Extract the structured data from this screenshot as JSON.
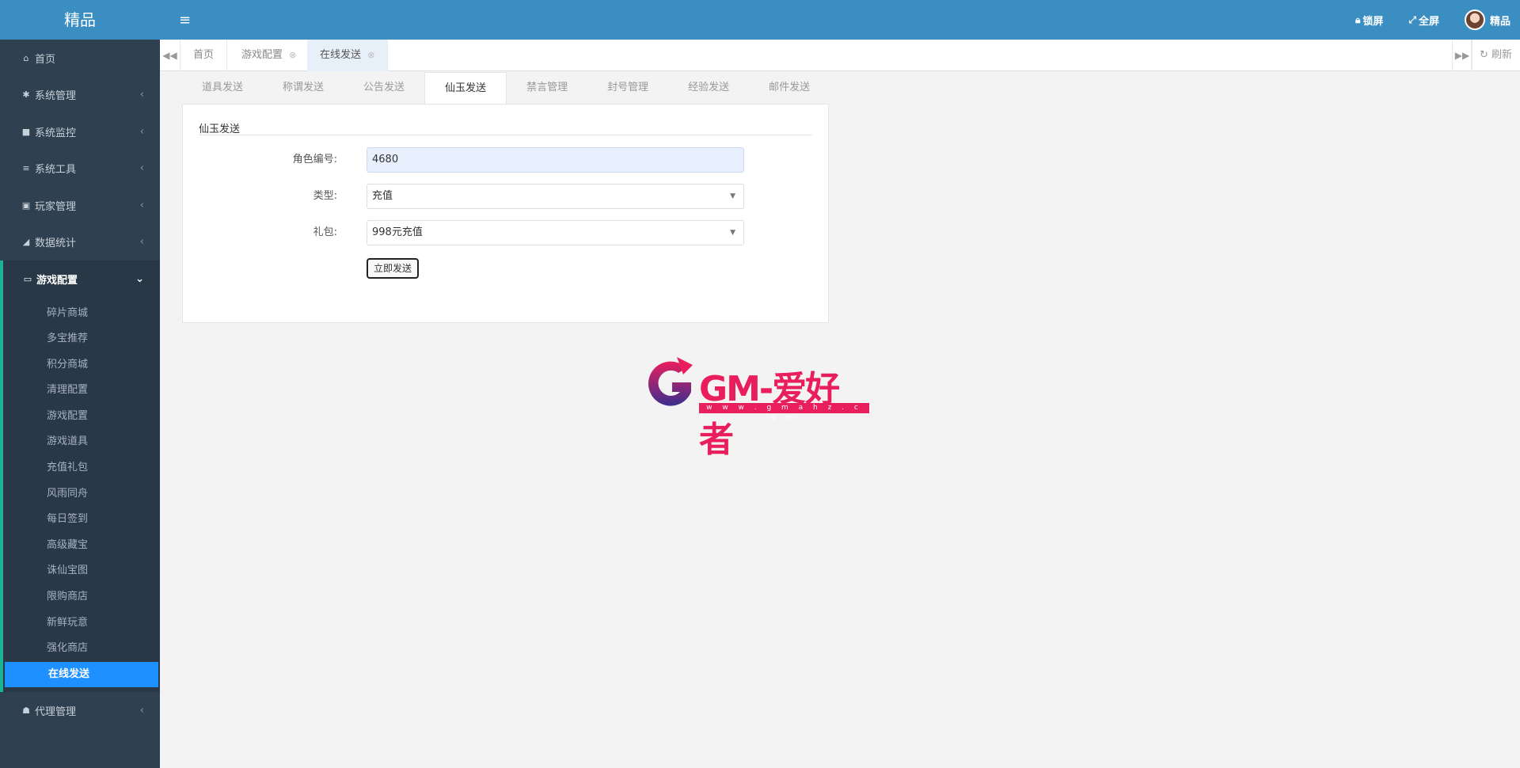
{
  "brand": "精品",
  "header": {
    "lock_label": "锁屏",
    "fullscreen_label": "全屏",
    "user_name": "精品"
  },
  "sidebar": {
    "items": [
      {
        "label": "首页",
        "icon": "home-icon"
      },
      {
        "label": "系统管理",
        "icon": "gear-icon"
      },
      {
        "label": "系统监控",
        "icon": "video-icon"
      },
      {
        "label": "系统工具",
        "icon": "list-icon"
      },
      {
        "label": "玩家管理",
        "icon": "user-card-icon"
      },
      {
        "label": "数据统计",
        "icon": "area-chart-icon"
      },
      {
        "label": "游戏配置",
        "icon": "desktop-icon"
      },
      {
        "label": "代理管理",
        "icon": "users-icon"
      }
    ],
    "game_config_sub": [
      "碎片商城",
      "多宝推荐",
      "积分商城",
      "清理配置",
      "游戏配置",
      "游戏道具",
      "充值礼包",
      "风雨同舟",
      "每日签到",
      "高级藏宝",
      "诛仙宝图",
      "限购商店",
      "新鲜玩意",
      "强化商店",
      "在线发送"
    ]
  },
  "page_tabs": [
    {
      "label": "首页"
    },
    {
      "label": "游戏配置"
    },
    {
      "label": "在线发送"
    }
  ],
  "refresh_label": "刷新",
  "sub_tabs": [
    "道具发送",
    "称谓发送",
    "公告发送",
    "仙玉发送",
    "禁言管理",
    "封号管理",
    "经验发送",
    "邮件发送"
  ],
  "form": {
    "title": "仙玉发送",
    "role_label": "角色编号:",
    "role_value": "4680",
    "type_label": "类型:",
    "type_value": "充值",
    "gift_label": "礼包:",
    "gift_value": "998元充值",
    "send_label": "立即发送"
  },
  "logo": {
    "text": "GM-爱好者",
    "url": "w w w . g m a h z . c o m"
  },
  "colors": {
    "topbar": "#3a8ec1",
    "sidebar": "#2f4050",
    "active_item": "#1e90ff",
    "logo": "#e91e5c"
  }
}
